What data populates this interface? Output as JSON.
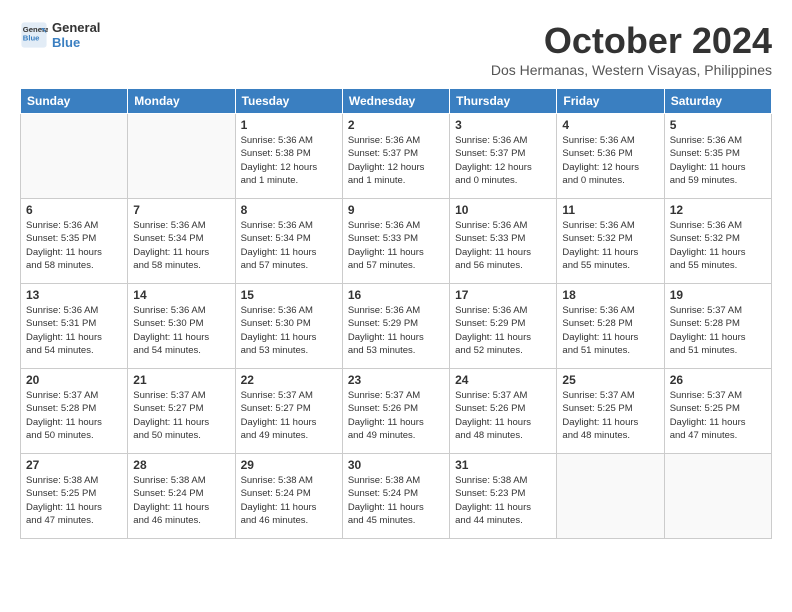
{
  "header": {
    "logo_line1": "General",
    "logo_line2": "Blue",
    "month_title": "October 2024",
    "subtitle": "Dos Hermanas, Western Visayas, Philippines"
  },
  "weekdays": [
    "Sunday",
    "Monday",
    "Tuesday",
    "Wednesday",
    "Thursday",
    "Friday",
    "Saturday"
  ],
  "weeks": [
    [
      {
        "day": null,
        "info": null
      },
      {
        "day": null,
        "info": null
      },
      {
        "day": "1",
        "info": "Sunrise: 5:36 AM\nSunset: 5:38 PM\nDaylight: 12 hours\nand 1 minute."
      },
      {
        "day": "2",
        "info": "Sunrise: 5:36 AM\nSunset: 5:37 PM\nDaylight: 12 hours\nand 1 minute."
      },
      {
        "day": "3",
        "info": "Sunrise: 5:36 AM\nSunset: 5:37 PM\nDaylight: 12 hours\nand 0 minutes."
      },
      {
        "day": "4",
        "info": "Sunrise: 5:36 AM\nSunset: 5:36 PM\nDaylight: 12 hours\nand 0 minutes."
      },
      {
        "day": "5",
        "info": "Sunrise: 5:36 AM\nSunset: 5:35 PM\nDaylight: 11 hours\nand 59 minutes."
      }
    ],
    [
      {
        "day": "6",
        "info": "Sunrise: 5:36 AM\nSunset: 5:35 PM\nDaylight: 11 hours\nand 58 minutes."
      },
      {
        "day": "7",
        "info": "Sunrise: 5:36 AM\nSunset: 5:34 PM\nDaylight: 11 hours\nand 58 minutes."
      },
      {
        "day": "8",
        "info": "Sunrise: 5:36 AM\nSunset: 5:34 PM\nDaylight: 11 hours\nand 57 minutes."
      },
      {
        "day": "9",
        "info": "Sunrise: 5:36 AM\nSunset: 5:33 PM\nDaylight: 11 hours\nand 57 minutes."
      },
      {
        "day": "10",
        "info": "Sunrise: 5:36 AM\nSunset: 5:33 PM\nDaylight: 11 hours\nand 56 minutes."
      },
      {
        "day": "11",
        "info": "Sunrise: 5:36 AM\nSunset: 5:32 PM\nDaylight: 11 hours\nand 55 minutes."
      },
      {
        "day": "12",
        "info": "Sunrise: 5:36 AM\nSunset: 5:32 PM\nDaylight: 11 hours\nand 55 minutes."
      }
    ],
    [
      {
        "day": "13",
        "info": "Sunrise: 5:36 AM\nSunset: 5:31 PM\nDaylight: 11 hours\nand 54 minutes."
      },
      {
        "day": "14",
        "info": "Sunrise: 5:36 AM\nSunset: 5:30 PM\nDaylight: 11 hours\nand 54 minutes."
      },
      {
        "day": "15",
        "info": "Sunrise: 5:36 AM\nSunset: 5:30 PM\nDaylight: 11 hours\nand 53 minutes."
      },
      {
        "day": "16",
        "info": "Sunrise: 5:36 AM\nSunset: 5:29 PM\nDaylight: 11 hours\nand 53 minutes."
      },
      {
        "day": "17",
        "info": "Sunrise: 5:36 AM\nSunset: 5:29 PM\nDaylight: 11 hours\nand 52 minutes."
      },
      {
        "day": "18",
        "info": "Sunrise: 5:36 AM\nSunset: 5:28 PM\nDaylight: 11 hours\nand 51 minutes."
      },
      {
        "day": "19",
        "info": "Sunrise: 5:37 AM\nSunset: 5:28 PM\nDaylight: 11 hours\nand 51 minutes."
      }
    ],
    [
      {
        "day": "20",
        "info": "Sunrise: 5:37 AM\nSunset: 5:28 PM\nDaylight: 11 hours\nand 50 minutes."
      },
      {
        "day": "21",
        "info": "Sunrise: 5:37 AM\nSunset: 5:27 PM\nDaylight: 11 hours\nand 50 minutes."
      },
      {
        "day": "22",
        "info": "Sunrise: 5:37 AM\nSunset: 5:27 PM\nDaylight: 11 hours\nand 49 minutes."
      },
      {
        "day": "23",
        "info": "Sunrise: 5:37 AM\nSunset: 5:26 PM\nDaylight: 11 hours\nand 49 minutes."
      },
      {
        "day": "24",
        "info": "Sunrise: 5:37 AM\nSunset: 5:26 PM\nDaylight: 11 hours\nand 48 minutes."
      },
      {
        "day": "25",
        "info": "Sunrise: 5:37 AM\nSunset: 5:25 PM\nDaylight: 11 hours\nand 48 minutes."
      },
      {
        "day": "26",
        "info": "Sunrise: 5:37 AM\nSunset: 5:25 PM\nDaylight: 11 hours\nand 47 minutes."
      }
    ],
    [
      {
        "day": "27",
        "info": "Sunrise: 5:38 AM\nSunset: 5:25 PM\nDaylight: 11 hours\nand 47 minutes."
      },
      {
        "day": "28",
        "info": "Sunrise: 5:38 AM\nSunset: 5:24 PM\nDaylight: 11 hours\nand 46 minutes."
      },
      {
        "day": "29",
        "info": "Sunrise: 5:38 AM\nSunset: 5:24 PM\nDaylight: 11 hours\nand 46 minutes."
      },
      {
        "day": "30",
        "info": "Sunrise: 5:38 AM\nSunset: 5:24 PM\nDaylight: 11 hours\nand 45 minutes."
      },
      {
        "day": "31",
        "info": "Sunrise: 5:38 AM\nSunset: 5:23 PM\nDaylight: 11 hours\nand 44 minutes."
      },
      {
        "day": null,
        "info": null
      },
      {
        "day": null,
        "info": null
      }
    ]
  ]
}
